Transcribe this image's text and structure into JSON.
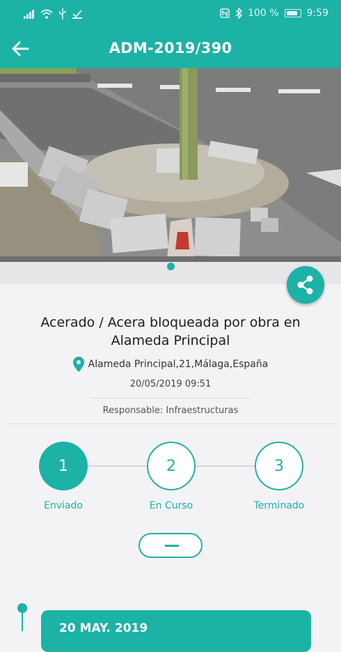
{
  "status_bar": {
    "battery_percent": "100 %",
    "time": "9:59",
    "icons": [
      "signal-icon",
      "wifi-icon",
      "usb-icon",
      "check-icon",
      "nfc-icon",
      "bluetooth-icon",
      "battery-icon"
    ]
  },
  "header": {
    "title": "ADM-2019/390",
    "back_icon": "arrow-left-icon"
  },
  "photo": {
    "indicator_active_index": 0
  },
  "share_button": {
    "icon": "share-icon"
  },
  "incident": {
    "title": "Acerado / Acera bloqueada por obra en Alameda Principal",
    "address": "Alameda Principal,21,Málaga,España",
    "date": "20/05/2019 09:51",
    "responsible": "Responsable: Infraestructuras"
  },
  "steps": [
    {
      "number": "1",
      "label": "Enviado",
      "state": "active"
    },
    {
      "number": "2",
      "label": "En Curso",
      "state": "pending"
    },
    {
      "number": "3",
      "label": "Terminado",
      "state": "pending"
    }
  ],
  "timeline": {
    "first_card_date": "20 MAY. 2019"
  },
  "colors": {
    "accent": "#1cb2a6",
    "background": "#f3f3f5",
    "divider": "#dcdcdc"
  }
}
